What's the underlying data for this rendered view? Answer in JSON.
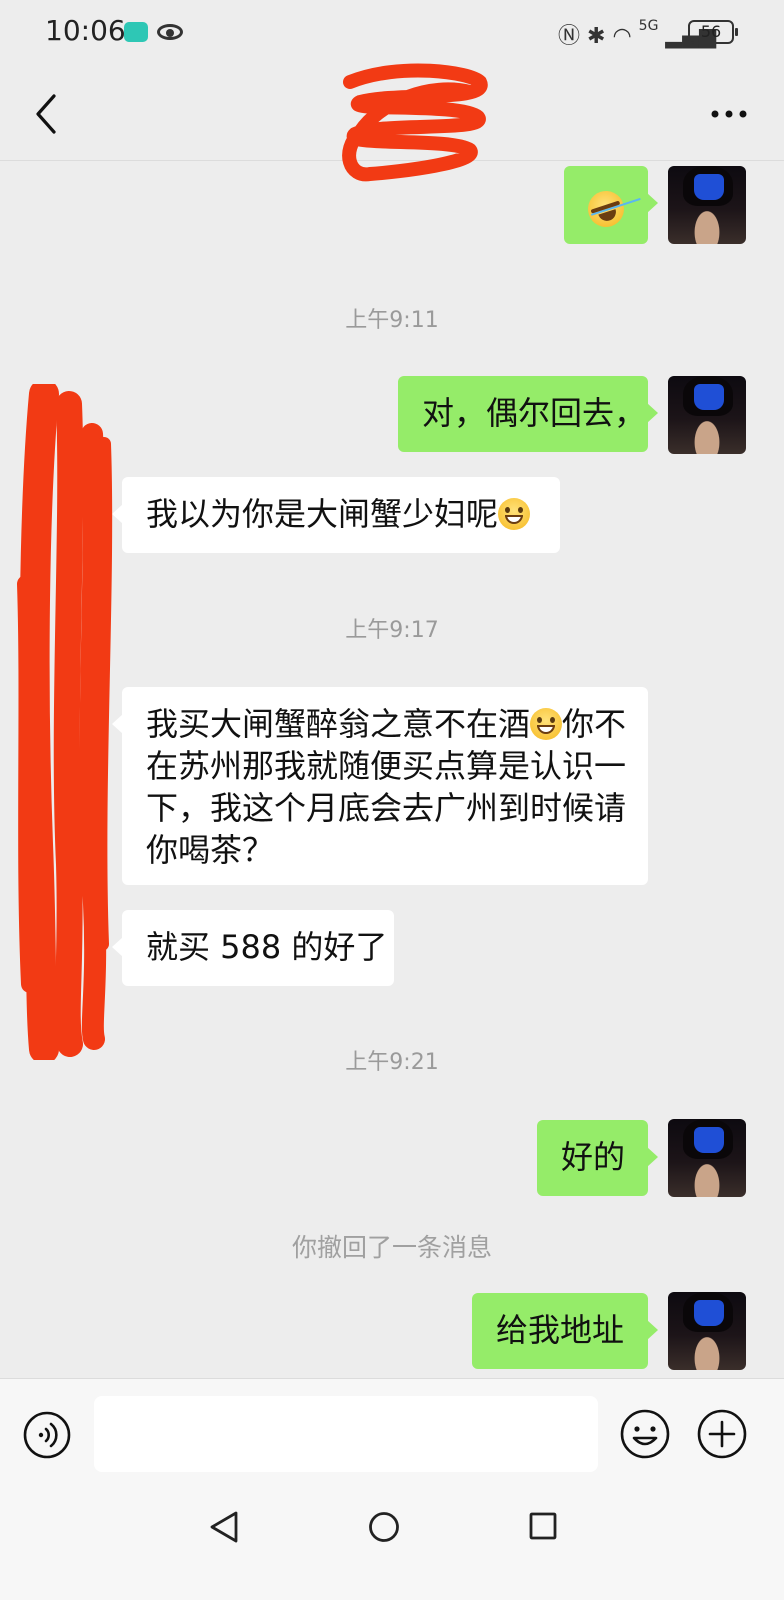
{
  "status_bar": {
    "time": "10:06",
    "network": "5G",
    "battery": "56"
  },
  "header": {
    "title_redacted": true
  },
  "messages": [
    {
      "side": "right",
      "type": "emoji",
      "emoji": "face-with-tears-of-joy"
    },
    {
      "type": "timestamp",
      "text": "上午9:11"
    },
    {
      "side": "right",
      "text": "对，偶尔回去，"
    },
    {
      "side": "left",
      "text": "我以为你是大闸蟹少妇呢",
      "emoji": "grinning-face"
    },
    {
      "type": "timestamp",
      "text": "上午9:17"
    },
    {
      "side": "left",
      "lines": [
        "我买大闸蟹醉翁之意不在酒",
        "你不",
        "在苏州那我就随便买点算是认识一",
        "下，我这个月底会去广州到时候请",
        "你喝茶？"
      ]
    },
    {
      "side": "left",
      "text": "就买 588 的好了"
    },
    {
      "type": "timestamp",
      "text": "上午9:21"
    },
    {
      "side": "right",
      "text": "好的"
    },
    {
      "type": "system",
      "text": "你撤回了一条消息"
    },
    {
      "side": "right",
      "text": "给我地址"
    }
  ],
  "input_bar": {
    "value": "",
    "icons": [
      "voice-icon",
      "emoji-icon",
      "plus-icon"
    ]
  },
  "nav_bar": {
    "icons": [
      "nav-back-icon",
      "nav-home-icon",
      "nav-recent-icon"
    ]
  },
  "colors": {
    "background": "#ededed",
    "sent_bubble": "#95ec69",
    "received_bubble": "#ffffff",
    "redaction": "#f23a14"
  }
}
